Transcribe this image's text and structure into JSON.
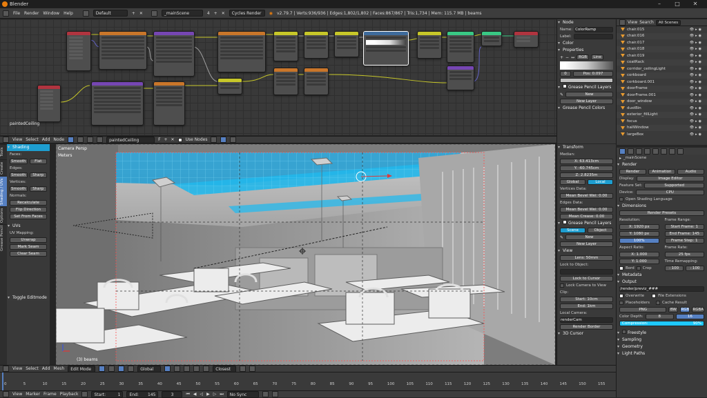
{
  "app": {
    "title": "Blender"
  },
  "window_controls": [
    "–",
    "□",
    "✕"
  ],
  "top_menu": {
    "items": [
      "File",
      "Render",
      "Window",
      "Help"
    ],
    "layout": "Default",
    "scene": "_mainScene",
    "scene_users": "4",
    "engine": "Cycles Render",
    "stats": "v2.79.7 | Verts:936/936 | Edges:1,802/1,802 | Faces:867/867 | Tris:1,734 | Mem: 115.7 MB | beams"
  },
  "node_editor": {
    "material_name": "paintedCeiling",
    "header": {
      "menus": [
        "View",
        "Select",
        "Add",
        "Node"
      ],
      "material": "paintedCeiling",
      "material_users": "F",
      "use_nodes": "Use Nodes"
    }
  },
  "node_sidebar": {
    "section_node": "Node",
    "name_label": "Name:",
    "name_value": "ColorRamp",
    "label_label": "Label:",
    "color_label": "Color",
    "properties_label": "Properties",
    "ramp_mode": "RGB",
    "ramp_interp": "Line",
    "ramp_index": "0",
    "ramp_pos": "Pos:  0.097",
    "gp_layers": "Grease Pencil Layers",
    "new_btn": "New",
    "new_layer_btn": "New Layer",
    "gp_colors": "Grease Pencil Colors"
  },
  "viewport": {
    "camera_label": "Camera Persp",
    "units_label": "Meters",
    "object_label": "(3) beams",
    "header": {
      "menus": [
        "View",
        "Select",
        "Add",
        "Mesh"
      ],
      "mode": "Edit Mode",
      "pivot": "Global",
      "snap": "Closest"
    }
  },
  "tool_tabs": [
    "Tools",
    "Create",
    "Shading / UVs",
    "Options",
    "Grease Pencil"
  ],
  "tool_shelf": {
    "shading_title": "Shading",
    "faces_label": "Faces:",
    "faces_buttons": [
      "Smooth",
      "Flat"
    ],
    "edges_label": "Edges:",
    "edges_buttons": [
      "Smooth",
      "Sharp"
    ],
    "vertices_label": "Vertices:",
    "vertices_buttons": [
      "Smooth",
      "Sharp"
    ],
    "normals_label": "Normals:",
    "normals_buttons": [
      "Recalculate",
      "Flip Direction",
      "Set From Faces"
    ],
    "uvs_title": "UVs",
    "uv_mapping_label": "UV Mapping:",
    "uv_mapping_buttons": [
      "Unwrap",
      "Mark Seam",
      "Clear Seam"
    ],
    "toggle_editmode": "Toggle Editmode"
  },
  "n_panel": {
    "transform_title": "Transform",
    "median_label": "Median:",
    "x": "X:      63.413cm",
    "y": "Y:     -60.745cm",
    "z": "Z:       2.8235m",
    "space_global": "Global",
    "space_local": "Local",
    "vertices_data": "Vertices Data:",
    "mean_bevel_wei_v": "Mean Bevel Wei: 0.00",
    "edges_data": "Edges Data:",
    "mean_bevel_wei_e": "Mean Bevel Wei: 0.00",
    "mean_crease": "Mean Crease:    0.00",
    "gp_layers": "Grease Pencil Layers",
    "scene_btn": "Scene",
    "object_btn": "Object",
    "new_btn": "New",
    "new_layer_btn": "New Layer",
    "view_title": "View",
    "lens": "Lens:          50mm",
    "lock_to_object": "Lock to Object:",
    "lock_to_cursor": "Lock to Cursor",
    "lock_camera": "Lock Camera to View",
    "clip_label": "Clip:",
    "clip_start": "Start:          10cm",
    "clip_end": "End:             1km",
    "local_camera": "Local Camera:",
    "render_cam": "renderCam",
    "render_border": "Render Border",
    "cursor_3d": "3D Cursor"
  },
  "outliner": {
    "header": [
      "View",
      "Search",
      "All Scenes"
    ],
    "items": [
      "chair.015",
      "chair.016",
      "chair.017",
      "chair.018",
      "chair.019",
      "coatRack",
      "corridor_ceilingLight",
      "corkboard",
      "corkboard.001",
      "doorFrame",
      "doorFrame.001",
      "door_window",
      "dustBin",
      "exterior_fillLight",
      "focus",
      "hallWindow",
      "largeBox"
    ]
  },
  "properties": {
    "scene": "_mainScene",
    "render_title": "Render",
    "render_buttons": [
      "Render",
      "Animation",
      "Audio"
    ],
    "display_label": "Display:",
    "display_value": "Image Editor",
    "feature_set_label": "Feature Set:",
    "feature_set_value": "Supported",
    "device_label": "Device:",
    "device_value": "CPU",
    "osl": "Open Shading Language",
    "dimensions_title": "Dimensions",
    "render_presets": "Render Presets",
    "resolution_label": "Resolution:",
    "res_x": "X:     1920 px",
    "res_y": "Y:     1080 px",
    "res_pct": "100%",
    "frame_range_label": "Frame Range:",
    "start_frame": "Start Frame:     1",
    "end_frame": "End Frame:   145",
    "frame_step": "Frame Step:      1",
    "aspect_label": "Aspect Ratio:",
    "asp_x": "X:        1.000",
    "asp_y": "Y:        1.000",
    "frame_rate_label": "Frame Rate:",
    "frame_rate": "25 fps",
    "time_remap": "Time Remapping:",
    "remap_old": ": 100",
    "remap_new": ": 100",
    "bord": "Bord",
    "crop": "Crop",
    "metadata": "Metadata",
    "output_title": "Output",
    "output_path": "/render/previz_###",
    "overwrite": "Overwrite",
    "file_extensions": "File Extensions",
    "placeholders": "Placeholders",
    "cache_result": "Cache Result",
    "format": "PNG",
    "color_modes": [
      "BW",
      "RGB",
      "RGBA"
    ],
    "color_depth_label": "Color Depth:",
    "color_depth": [
      "8",
      "16"
    ],
    "compression": "Compression:",
    "compression_value": "90%",
    "freestyle": "Freestyle",
    "sampling": "Sampling",
    "geometry": "Geometry",
    "light_paths": "Light Paths"
  },
  "timeline": {
    "ticks": [
      "0",
      "5",
      "10",
      "15",
      "20",
      "25",
      "30",
      "35",
      "40",
      "45",
      "50",
      "55",
      "60",
      "65",
      "70",
      "75",
      "80",
      "85",
      "90",
      "95",
      "100",
      "105",
      "110",
      "115",
      "120",
      "125",
      "130",
      "135",
      "140",
      "145",
      "150",
      "155"
    ],
    "footer_menus": [
      "View",
      "Marker",
      "Frame",
      "Playback"
    ],
    "start": "Start:",
    "start_value": "1",
    "end": "End:",
    "end_value": "145",
    "current": "3",
    "sync": "No Sync"
  },
  "colors": {
    "accent": "#5680c2",
    "highlight_cyan": "#1ec8ff",
    "blender_orange": "#e87d0d"
  }
}
